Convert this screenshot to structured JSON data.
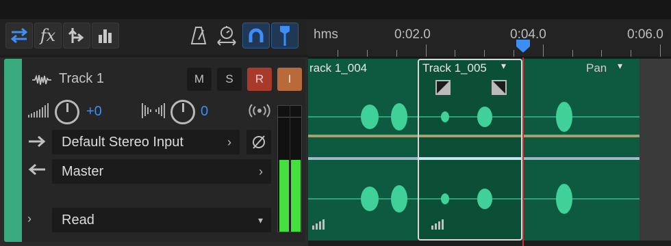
{
  "toolbar": {
    "left_buttons": [
      {
        "name": "switch-view-icon",
        "active": true
      },
      {
        "name": "fx-icon",
        "label": "fx"
      },
      {
        "name": "send-icon"
      },
      {
        "name": "meter-view-icon"
      }
    ],
    "right_buttons": [
      {
        "name": "metronome-icon",
        "active": false
      },
      {
        "name": "stopwatch-icon",
        "active": false
      },
      {
        "name": "snap-magnet-icon",
        "active": true
      },
      {
        "name": "snap-marker-icon",
        "active": true
      }
    ]
  },
  "ruler": {
    "unit": "hms",
    "labels": [
      "0:02.0",
      "0:04.0",
      "0:06.0"
    ]
  },
  "track": {
    "name": "Track 1",
    "buttons": {
      "mute": "M",
      "solo": "S",
      "record": "R",
      "input": "I"
    },
    "volume_value": "+0",
    "pan_value": "0",
    "input_device": "Default Stereo Input",
    "output": "Master",
    "automation_mode": "Read",
    "meter_level": 0.57,
    "color": "#3aaa7f"
  },
  "clips": [
    {
      "label": "rack 1_004"
    },
    {
      "label": "Track 1_005",
      "selected": true
    },
    {
      "label": "Pan"
    }
  ],
  "colors": {
    "accent": "#3d8ef5",
    "record": "#a83a2c",
    "input": "#b86a3a",
    "clip_bg": "#0e5a40",
    "waveform": "#3fd198",
    "playhead": "#c93333"
  }
}
